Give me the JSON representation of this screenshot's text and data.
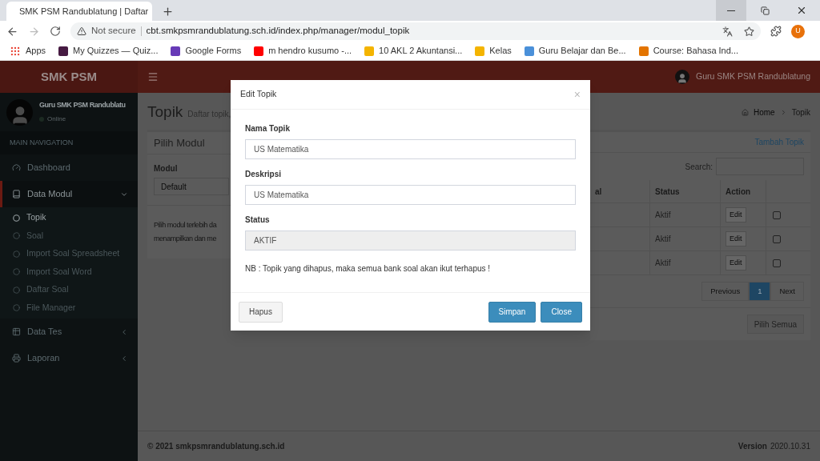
{
  "browser": {
    "tab_title": "SMK PSM Randublatung | Daftar",
    "address": {
      "warning": "Not secure",
      "url": "cbt.smkpsmrandublatung.sch.id/index.php/manager/modul_topik"
    },
    "profile": "U",
    "bookmarks": [
      {
        "label": "Apps",
        "color": "#ea4335"
      },
      {
        "label": "My Quizzes — Quiz...",
        "color": "#461a42"
      },
      {
        "label": "Google Forms",
        "color": "#673ab7"
      },
      {
        "label": "m hendro kusumo -...",
        "color": "#ff0000"
      },
      {
        "label": "10 AKL 2 Akuntansi...",
        "color": "#f4b400"
      },
      {
        "label": "Kelas",
        "color": "#f4b400"
      },
      {
        "label": "Guru Belajar dan Be...",
        "color": "#4a90d9"
      },
      {
        "label": "Course: Bahasa Ind...",
        "color": "#e37400"
      }
    ]
  },
  "header": {
    "logo": "SMK PSM",
    "user": "Guru SMK PSM Randublatung"
  },
  "sidebar": {
    "user": "Guru SMK PSM Randublatu",
    "status": "Online",
    "nav_header": "MAIN NAVIGATION",
    "items": [
      {
        "label": "Dashboard",
        "selected": false,
        "expanded": false
      },
      {
        "label": "Data Modul",
        "selected": true,
        "expanded": true,
        "children": [
          {
            "label": "Topik",
            "selected": true
          },
          {
            "label": "Soal",
            "selected": false
          },
          {
            "label": "Import Soal Spreadsheet",
            "selected": false
          },
          {
            "label": "Import Soal Word",
            "selected": false
          },
          {
            "label": "Daftar Soal",
            "selected": false
          },
          {
            "label": "File Manager",
            "selected": false
          }
        ]
      },
      {
        "label": "Data Tes",
        "selected": false,
        "expanded": false
      },
      {
        "label": "Laporan",
        "selected": false,
        "expanded": false
      }
    ]
  },
  "content": {
    "title": "Topik",
    "subtitle": "Daftar topik,",
    "breadcrumb": [
      "Home",
      "Topik"
    ],
    "module_box": {
      "title": "Pilih Modul",
      "label": "Modul",
      "select_value": "Default",
      "note": [
        "Pilih modul terlebih da",
        "menampilkan dan me"
      ]
    },
    "topic_box": {
      "add_link": "Tambah Topik",
      "search_label": "Search:",
      "columns": [
        "al",
        "Status",
        "Action"
      ],
      "rows": [
        {
          "status": "Aktif",
          "action": "Edit",
          "checked": false
        },
        {
          "status": "Aktif",
          "action": "Edit",
          "checked": false
        },
        {
          "status": "Aktif",
          "action": "Edit",
          "checked": false
        }
      ],
      "pagination": [
        {
          "label": "Previous",
          "selected": false
        },
        {
          "label": "1",
          "selected": true
        },
        {
          "label": "Next",
          "selected": false
        }
      ],
      "select_all": "Pilih Semua"
    }
  },
  "footer": {
    "copyright": "© 2021 smkpsmrandublatung.sch.id",
    "version_label": "Version",
    "version": "2020.10.31"
  },
  "modal": {
    "title": "Edit Topik",
    "close": "×",
    "fields": [
      {
        "label": "Nama Topik",
        "value": "US Matematika",
        "disabled": false
      },
      {
        "label": "Deskripsi",
        "value": "US Matematika",
        "disabled": false
      },
      {
        "label": "Status",
        "value": "AKTIF",
        "disabled": true
      }
    ],
    "note": "NB : Topik yang dihapus, maka semua bank soal akan ikut terhapus !",
    "buttons": [
      {
        "label": "Hapus",
        "kind": "default"
      },
      {
        "label": "Simpan",
        "kind": "primary"
      },
      {
        "label": "Close",
        "kind": "primary"
      }
    ]
  }
}
